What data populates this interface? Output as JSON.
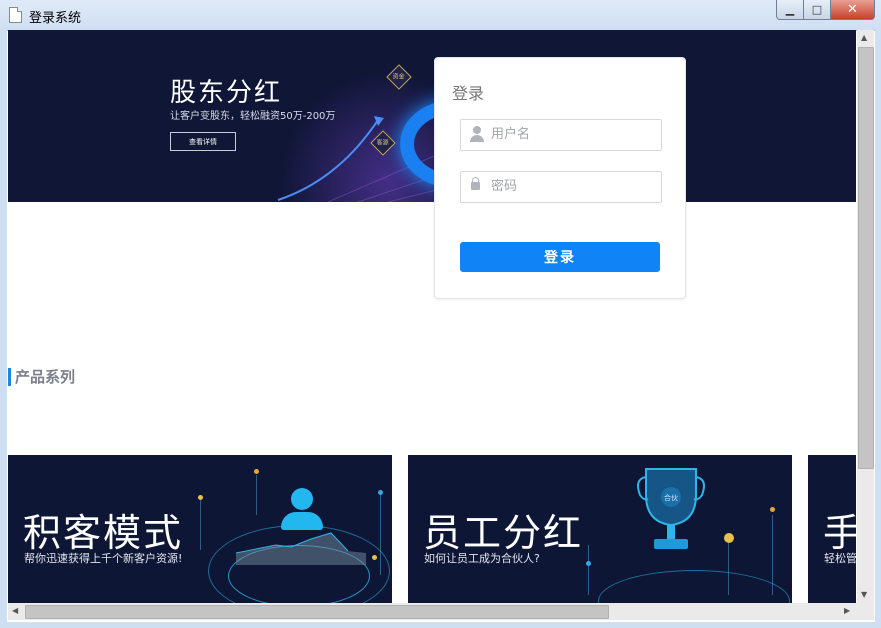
{
  "window": {
    "title": "登录系统",
    "min_glyph": "▁",
    "max_glyph": "□",
    "close_glyph": "✕"
  },
  "banner": {
    "title": "股东分红",
    "subtitle": "让客户变股东，轻松融资50万-200万",
    "button_label": "查看详情",
    "badges": [
      "资金",
      "客源"
    ]
  },
  "login": {
    "title": "登录",
    "username_placeholder": "用户名",
    "password_placeholder": "密码",
    "submit_label": "登录"
  },
  "section": {
    "title": "产品系列"
  },
  "products": [
    {
      "title": "积客模式",
      "subtitle": "帮你迅速获得上千个新客户资源!"
    },
    {
      "title": "员工分红",
      "subtitle": "如何让员工成为合伙人?",
      "badge": "合伙"
    },
    {
      "title": "手",
      "subtitle": "轻松管"
    }
  ],
  "scrollbars": {
    "up": "▲",
    "down": "▼",
    "left": "◀",
    "right": "▶"
  }
}
